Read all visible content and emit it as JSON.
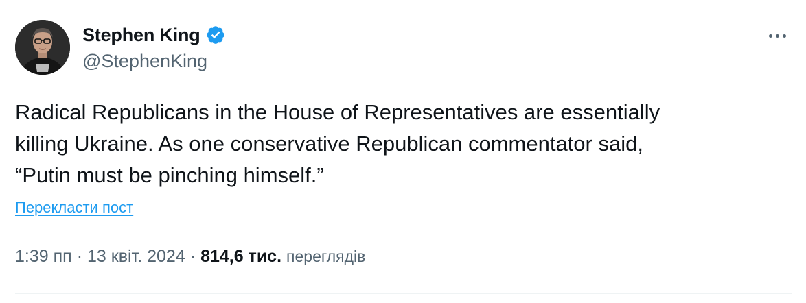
{
  "author": {
    "display_name": "Stephen King",
    "handle": "@StephenKing",
    "verified_icon": "verified-badge-icon",
    "verified_color": "#1d9bf0"
  },
  "menu": {
    "icon": "more-horizontal-icon"
  },
  "post": {
    "lines": [
      "Radical Republicans in the House of Representatives are essentially",
      "killing Ukraine. As one conservative Republican commentator said,",
      "“Putin must be pinching himself.”"
    ],
    "translate_label": "Перекласти пост"
  },
  "meta": {
    "time": "1:39 пп",
    "separator": "·",
    "date": "13 квіт. 2024",
    "views_count": "814,6 тис.",
    "views_label": "переглядів"
  },
  "colors": {
    "text": "#0f1419",
    "secondary": "#536471",
    "link": "#1d9bf0"
  }
}
